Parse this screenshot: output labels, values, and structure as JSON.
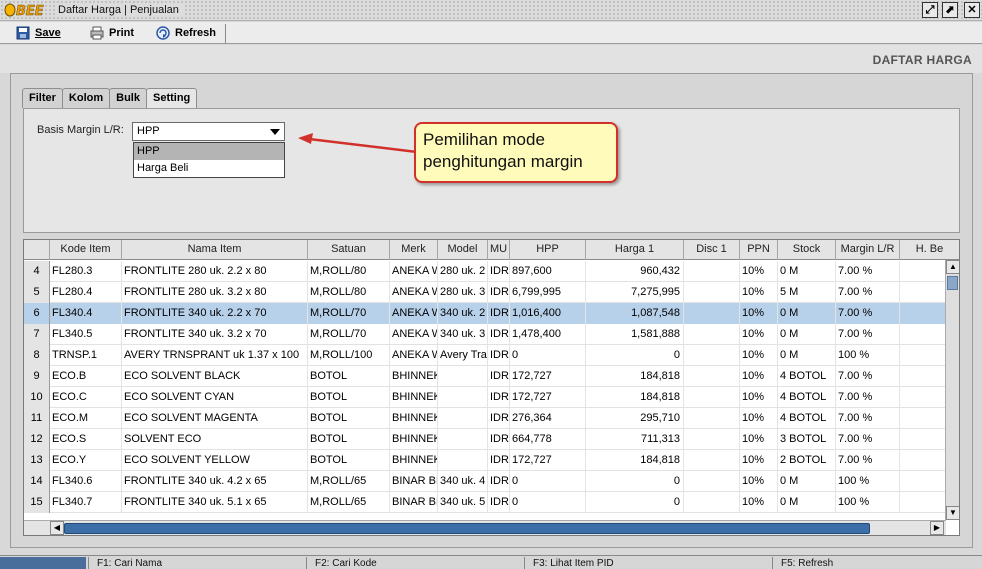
{
  "window": {
    "logo_text": "BEE",
    "title": "Daftar Harga | Penjualan"
  },
  "toolbar": {
    "save_label": "Save",
    "print_label": "Print",
    "refresh_label": "Refresh"
  },
  "header": {
    "title": "DAFTAR HARGA"
  },
  "tabs": [
    {
      "label": "Filter"
    },
    {
      "label": "Kolom"
    },
    {
      "label": "Bulk"
    },
    {
      "label": "Setting",
      "active": true
    }
  ],
  "setting": {
    "basis_label": "Basis Margin L/R:",
    "selected": "HPP",
    "options": [
      "HPP",
      "Harga Beli"
    ]
  },
  "callout": {
    "line1": "Pemilihan mode",
    "line2": "penghitungan margin"
  },
  "table": {
    "columns": [
      "",
      "Kode Item",
      "Nama Item",
      "Satuan",
      "Merk",
      "Model",
      "MU",
      "HPP",
      "Harga 1",
      "Disc 1",
      "PPN",
      "Stock",
      "Margin L/R",
      "H. Be"
    ],
    "rows": [
      [
        "4",
        "FL280.3",
        "FRONTLITE 280 uk. 2.2 x 80",
        "M,ROLL/80",
        "ANEKA W",
        "280 uk. 2",
        "IDR",
        "897,600",
        "960,432",
        "",
        "10%",
        "0 M",
        "7.00 %",
        ""
      ],
      [
        "5",
        "FL280.4",
        "FRONTLITE 280 uk. 3.2 x 80",
        "M,ROLL/80",
        "ANEKA W",
        "280 uk. 3",
        "IDR",
        "6,799,995",
        "7,275,995",
        "",
        "10%",
        "5 M",
        "7.00 %",
        ""
      ],
      [
        "6",
        "FL340.4",
        "FRONTLITE 340 uk. 2.2 x 70",
        "M,ROLL/70",
        "ANEKA W",
        "340 uk. 2",
        "IDR",
        "1,016,400",
        "1,087,548",
        "",
        "10%",
        "0 M",
        "7.00 %",
        ""
      ],
      [
        "7",
        "FL340.5",
        "FRONTLITE 340 uk. 3.2 x 70",
        "M,ROLL/70",
        "ANEKA W",
        "340 uk. 3",
        "IDR",
        "1,478,400",
        "1,581,888",
        "",
        "10%",
        "0 M",
        "7.00 %",
        ""
      ],
      [
        "8",
        "TRNSP.1",
        "AVERY TRNSPRANT uk 1.37 x 100",
        "M,ROLL/100",
        "ANEKA W",
        "Avery Tra",
        "IDR",
        "0",
        "0",
        "",
        "10%",
        "0 M",
        "100 %",
        ""
      ],
      [
        "9",
        "ECO.B",
        "ECO SOLVENT BLACK",
        "BOTOL",
        "BHINNEKA",
        "",
        "IDR",
        "172,727",
        "184,818",
        "",
        "10%",
        "4 BOTOL",
        "7.00 %",
        ""
      ],
      [
        "10",
        "ECO.C",
        "ECO SOLVENT CYAN",
        "BOTOL",
        "BHINNEKA",
        "",
        "IDR",
        "172,727",
        "184,818",
        "",
        "10%",
        "4 BOTOL",
        "7.00 %",
        ""
      ],
      [
        "11",
        "ECO.M",
        "ECO SOLVENT MAGENTA",
        "BOTOL",
        "BHINNEKA",
        "",
        "IDR",
        "276,364",
        "295,710",
        "",
        "10%",
        "4 BOTOL",
        "7.00 %",
        ""
      ],
      [
        "12",
        "ECO.S",
        "SOLVENT ECO",
        "BOTOL",
        "BHINNEKA",
        "",
        "IDR",
        "664,778",
        "711,313",
        "",
        "10%",
        "3 BOTOL",
        "7.00 %",
        ""
      ],
      [
        "13",
        "ECO.Y",
        "ECO SOLVENT YELLOW",
        "BOTOL",
        "BHINNEKA",
        "",
        "IDR",
        "172,727",
        "184,818",
        "",
        "10%",
        "2 BOTOL",
        "7.00 %",
        ""
      ],
      [
        "14",
        "FL340.6",
        "FRONTLITE 340 uk. 4.2 x 65",
        "M,ROLL/65",
        "BINAR BE",
        "340 uk. 4",
        "IDR",
        "0",
        "0",
        "",
        "10%",
        "0 M",
        "100 %",
        ""
      ],
      [
        "15",
        "FL340.7",
        "FRONTLITE 340 uk. 5.1 x 65",
        "M,ROLL/65",
        "BINAR BE",
        "340 uk. 5",
        "IDR",
        "0",
        "0",
        "",
        "10%",
        "0 M",
        "100 %",
        ""
      ]
    ],
    "selected_row": 2
  },
  "statusbar": {
    "f1": "F1: Cari Nama",
    "f2": "F2: Cari Kode",
    "f3": "F3: Lihat Item PID",
    "f5": "F5: Refresh"
  }
}
